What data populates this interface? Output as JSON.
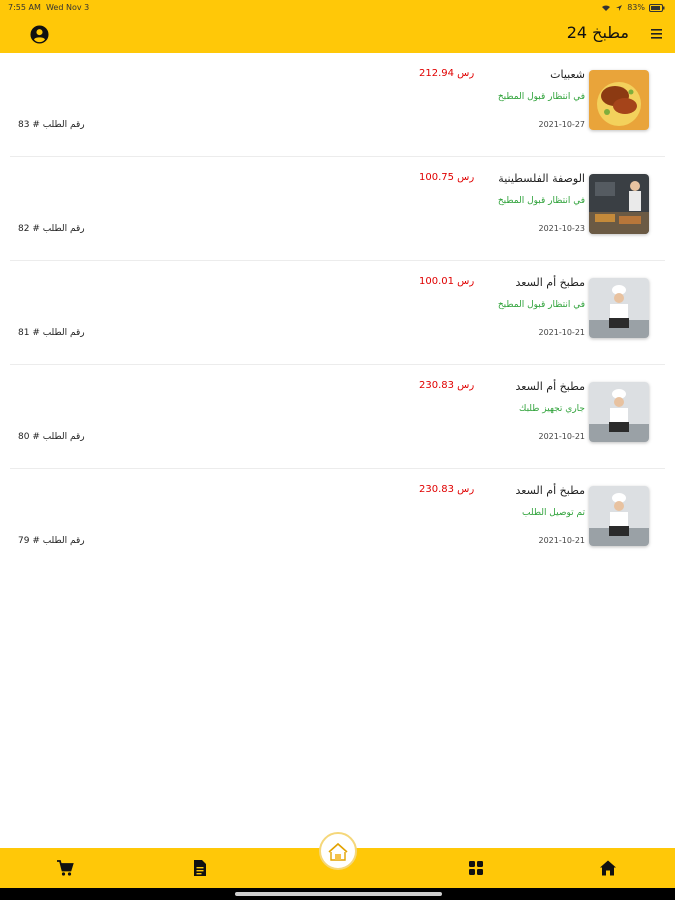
{
  "status_bar": {
    "time": "7:55 AM",
    "date": "Wed Nov 3",
    "battery": "83%"
  },
  "app_bar": {
    "title": "مطبخ 24"
  },
  "orders": [
    {
      "name": "شعبيات",
      "price": "212.94 رس",
      "status": "في انتظار قبول المطبخ",
      "date": "2021-10-27",
      "order_number": "رقم الطلب # 83"
    },
    {
      "name": "الوصفة الفلسطينية",
      "price": "100.75 رس",
      "status": "في انتظار قبول المطبخ",
      "date": "2021-10-23",
      "order_number": "رقم الطلب # 82"
    },
    {
      "name": "مطبخ أم السعد",
      "price": "100.01 رس",
      "status": "في انتظار قبول المطبخ",
      "date": "2021-10-21",
      "order_number": "رقم الطلب # 81"
    },
    {
      "name": "مطبخ أم السعد",
      "price": "230.83 رس",
      "status": "جاري تجهيز طلبك",
      "date": "2021-10-21",
      "order_number": "رقم الطلب # 80"
    },
    {
      "name": "مطبخ أم السعد",
      "price": "230.83 رس",
      "status": "تم توصيل الطلب",
      "date": "2021-10-21",
      "order_number": "رقم الطلب # 79"
    }
  ],
  "bottom_nav": {
    "items": [
      "cart-icon",
      "document-icon",
      "app-logo",
      "grid-icon",
      "home-icon"
    ]
  },
  "logo": {
    "text": "مطبخ"
  },
  "colors": {
    "accent": "#ffc808",
    "price": "#e00000",
    "status": "#2fa23a"
  }
}
